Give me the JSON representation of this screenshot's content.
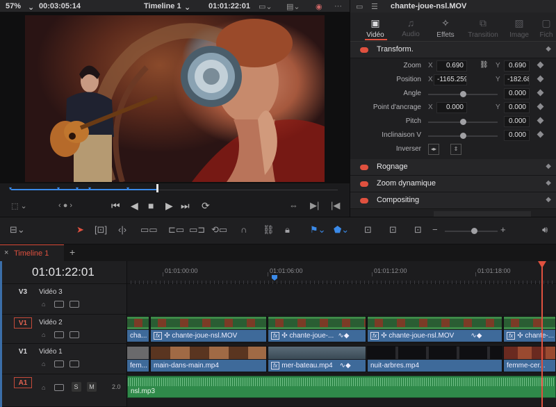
{
  "viewer": {
    "zoom": "57%",
    "source_timecode": "00:03:05:14",
    "timeline_name": "Timeline 1",
    "record_timecode": "01:01:22:01"
  },
  "inspector": {
    "clip_title": "chante-joue-nsl.MOV",
    "tabs": [
      {
        "label": "Vidéo",
        "icon": "film-icon",
        "active": true
      },
      {
        "label": "Audio",
        "icon": "note-icon",
        "active": false
      },
      {
        "label": "Effets",
        "icon": "effects-icon",
        "active": false
      },
      {
        "label": "Transition",
        "icon": "transition-icon",
        "active": false
      },
      {
        "label": "Image",
        "icon": "image-icon",
        "active": false
      },
      {
        "label": "Fich",
        "icon": "file-icon",
        "active": false
      }
    ],
    "transform": {
      "title": "Transform.",
      "zoom_label": "Zoom",
      "zoom_x": "0.690",
      "zoom_y": "0.690",
      "position_label": "Position",
      "position_x": "-1165.259",
      "position_y": "-182.681",
      "angle_label": "Angle",
      "angle": "0.000",
      "anchor_label": "Point d'ancrage",
      "anchor_x": "0.000",
      "anchor_y": "0.000",
      "pitch_label": "Pitch",
      "pitch": "0.000",
      "tilt_label": "Inclinaison V",
      "tilt": "0.000",
      "flip_label": "Inverser",
      "x_label": "X",
      "y_label": "Y"
    },
    "sections": [
      "Rognage",
      "Zoom dynamique",
      "Compositing"
    ]
  },
  "timeline": {
    "tab_label": "Timeline 1",
    "current_timecode": "01:01:22:01",
    "ruler_marks": [
      "01:01:00:00",
      "01:01:06:00",
      "01:01:12:00",
      "01:01:18:00"
    ],
    "tracks": [
      {
        "id": "V3",
        "name": "Vidéo 3"
      },
      {
        "id": "V1",
        "name": "Vidéo 2"
      },
      {
        "id": "V1",
        "name": "Vidéo 1"
      },
      {
        "id": "A1",
        "name": "",
        "level": "2.0"
      }
    ],
    "v2_clips": [
      "cha...",
      "chante-joue-nsl.MOV",
      "chante-joue-...",
      "chante-joue-nsl.MOV",
      "chante-..."
    ],
    "v1_clips": [
      "fem...",
      "main-dans-main.mp4",
      "mer-bateau.mp4",
      "nuit-arbres.mp4",
      "femme-cer..."
    ],
    "audio_clip": "nsl.mp3",
    "solo": "S",
    "mute": "M"
  },
  "colors": {
    "accent": "#e0513f",
    "clip_blue": "#3e6a9a",
    "audio_green": "#2f8a4a",
    "marker_blue": "#3b8ae8"
  }
}
